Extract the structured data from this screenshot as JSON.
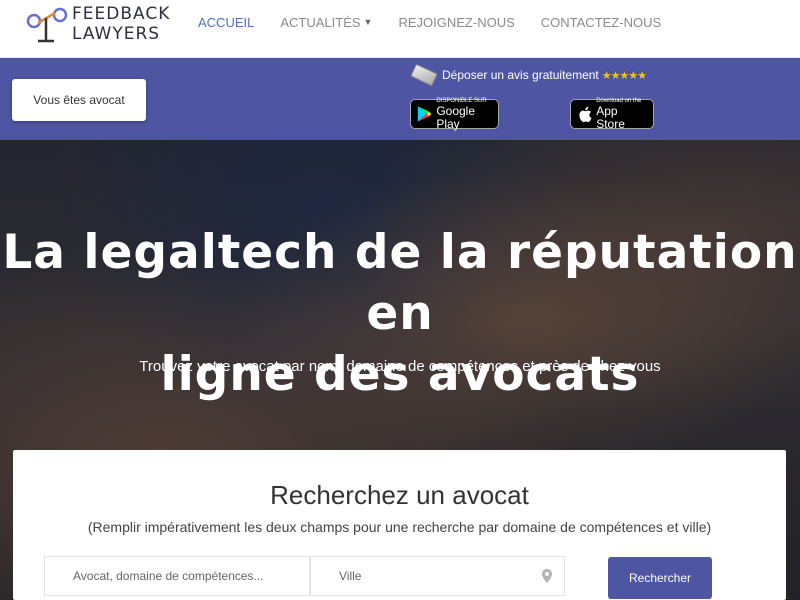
{
  "brand": {
    "line1": "FEEDBACK",
    "line2": "LAWYERS"
  },
  "nav": {
    "items": [
      {
        "label": "ACCUEIL"
      },
      {
        "label": "ACTUALITÉS"
      },
      {
        "label": "REJOIGNEZ-NOUS"
      },
      {
        "label": "CONTACTEZ-NOUS"
      }
    ]
  },
  "band": {
    "lawyer_button": "Vous êtes avocat",
    "review_text": "Déposer un avis gratuitement",
    "stars": "★★★★★",
    "google_play": {
      "small": "DISPONIBLE SUR",
      "big": "Google Play"
    },
    "app_store": {
      "small": "Download on the",
      "big": "App Store"
    }
  },
  "hero": {
    "title_line1": "La legaltech de la réputation en",
    "title_line2": "ligne des avocats",
    "subtitle": "Trouvez votre avocat par nom, domaine de compétences et près de chez vous"
  },
  "search": {
    "title": "Recherchez un avocat",
    "subtitle": "(Remplir impérativement les deux champs pour une recherche par domaine de compétences et ville)",
    "query_placeholder": "Avocat, domaine de compétences...",
    "city_placeholder": "Ville",
    "button": "Rechercher"
  },
  "colors": {
    "brand": "#4e55a3",
    "nav_active": "#4c6fd0",
    "stars": "#f3c023"
  },
  "icons": {
    "logo": "scales-logo-icon",
    "caret": "chevron-down-icon",
    "pin": "location-pin-icon",
    "phone": "phone-icon"
  }
}
